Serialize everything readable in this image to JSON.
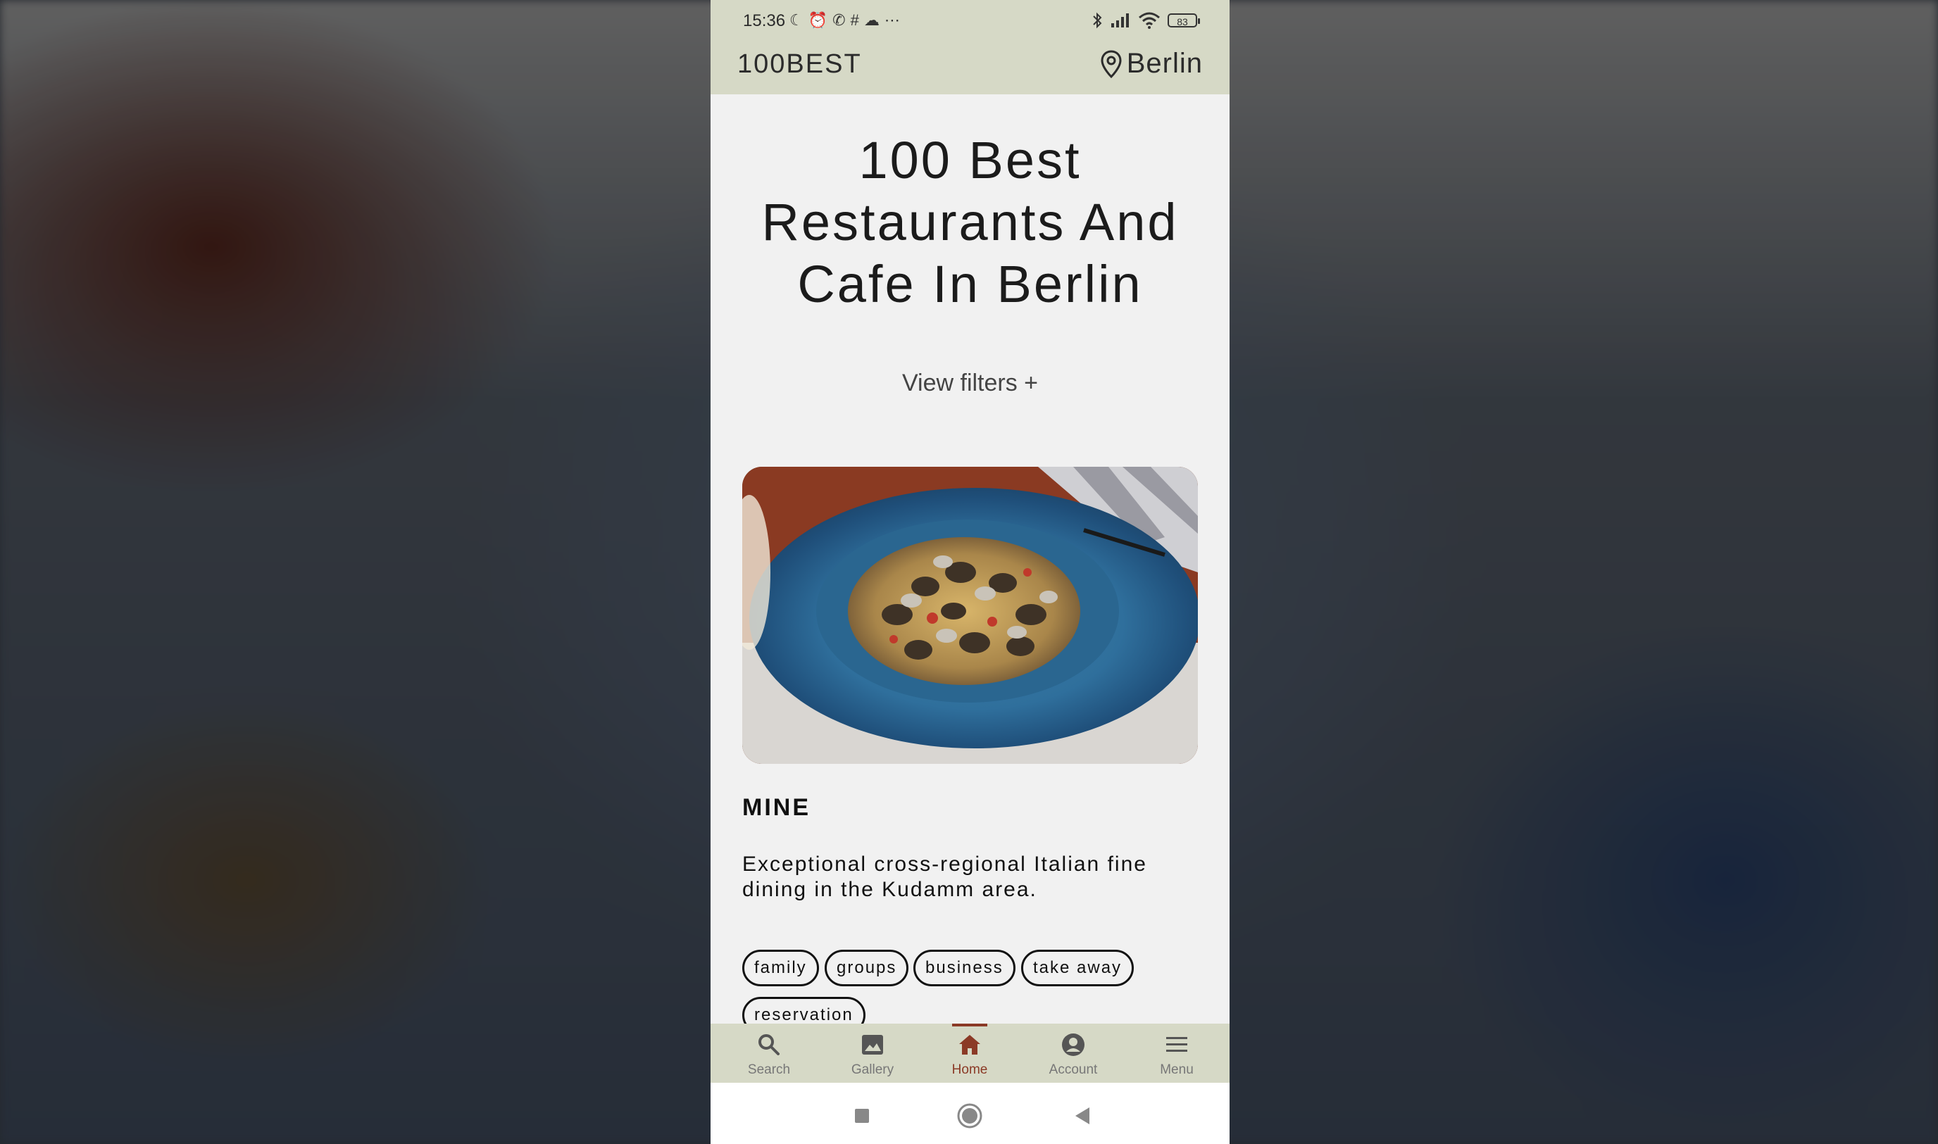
{
  "status_bar": {
    "time": "15:36",
    "battery": "83",
    "left_icons": [
      "moon-icon",
      "alarm-icon",
      "whatsapp-icon",
      "slack-icon",
      "app-icon",
      "more-icon"
    ],
    "right_icons": [
      "bluetooth-icon",
      "signal-icon",
      "wifi-icon",
      "battery-icon"
    ]
  },
  "app_bar": {
    "brand": "100BEST",
    "city": "Berlin",
    "city_icon": "location-pin-icon"
  },
  "main": {
    "headline": "100 Best Restaurants And Cafe In Berlin",
    "view_filters": "View filters +"
  },
  "card": {
    "image_alt": "Spaghetti with clams in a blue plate",
    "title": "MINE",
    "description": "Exceptional cross-regional Italian fine dining in the Kudamm area.",
    "tags": [
      "family",
      "groups",
      "business",
      "take away",
      "reservation"
    ]
  },
  "bottom_nav": {
    "items": [
      {
        "label": "Search",
        "icon": "search-icon"
      },
      {
        "label": "Gallery",
        "icon": "gallery-icon"
      },
      {
        "label": "Home",
        "icon": "home-icon",
        "active": true
      },
      {
        "label": "Account",
        "icon": "account-icon"
      },
      {
        "label": "Menu",
        "icon": "menu-icon"
      }
    ]
  },
  "colors": {
    "bar_background": "#d6d9c6",
    "accent": "#8b3a26",
    "content_background": "#f1f1f1"
  }
}
